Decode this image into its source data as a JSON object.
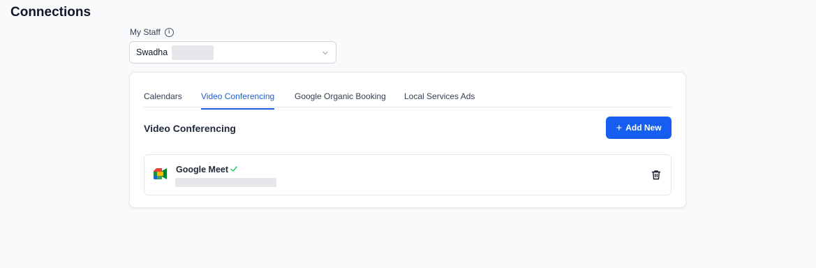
{
  "page": {
    "title": "Connections"
  },
  "staff": {
    "label": "My Staff",
    "selected_value": "Swadha",
    "info_icon": "info-icon",
    "chevron_icon": "chevron-down-icon"
  },
  "tabs": [
    {
      "label": "Calendars",
      "active": false
    },
    {
      "label": "Video Conferencing",
      "active": true
    },
    {
      "label": "Google Organic Booking",
      "active": false
    },
    {
      "label": "Local Services Ads",
      "active": false
    }
  ],
  "section": {
    "title": "Video Conferencing",
    "add_button_label": "Add New"
  },
  "connections": [
    {
      "name": "Google Meet",
      "connected": true,
      "icon": "google-meet-icon",
      "status_icon": "check-icon",
      "action_icon": "trash-icon"
    }
  ],
  "colors": {
    "accent": "#155eef",
    "active_tab": "#1d5fd6",
    "connected_check": "#22c55e"
  }
}
